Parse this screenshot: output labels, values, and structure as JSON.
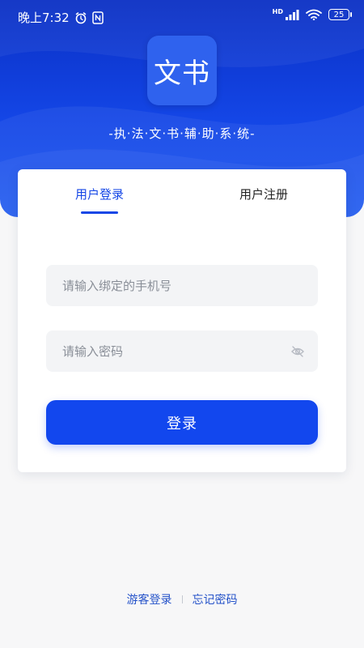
{
  "status_bar": {
    "time": "晚上7:32",
    "network": "HD",
    "battery": "25"
  },
  "header": {
    "logo_text": "文书",
    "subtitle": "-执·法·文·书·辅·助·系·统-"
  },
  "tabs": {
    "login": "用户登录",
    "register": "用户注册",
    "active": "login"
  },
  "form": {
    "phone_placeholder": "请输入绑定的手机号",
    "phone_value": "",
    "password_placeholder": "请输入密码",
    "password_value": "",
    "login_label": "登录"
  },
  "footer": {
    "guest_login": "游客登录",
    "forgot_password": "忘记密码"
  },
  "colors": {
    "primary": "#1446e6",
    "header_bg": "#0a2fc4",
    "page_bg": "#f7f7f8"
  }
}
